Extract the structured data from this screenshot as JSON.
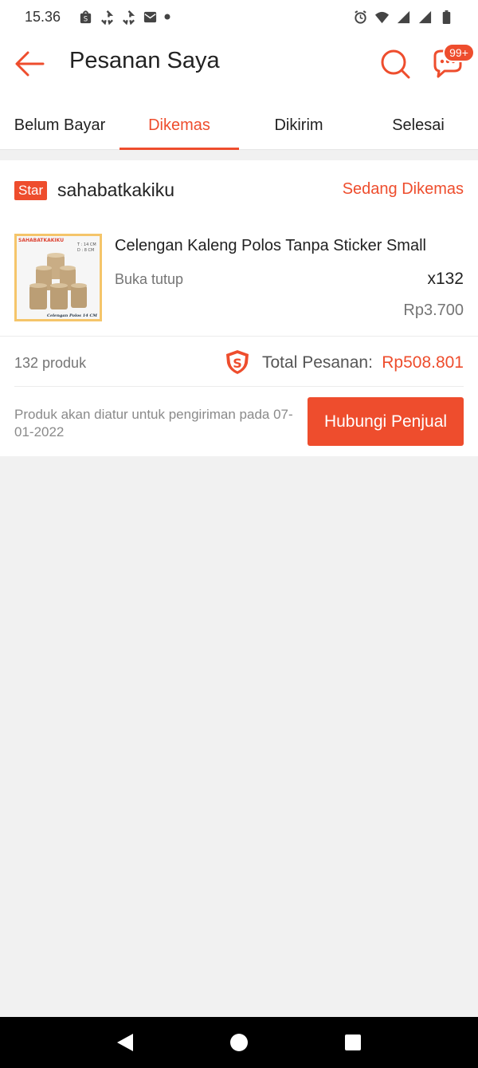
{
  "status_bar": {
    "time": "15.36",
    "left_icons": [
      "shopping-bag-icon",
      "sync-icon",
      "sync-icon",
      "mail-icon",
      "dot-icon"
    ],
    "right_icons": [
      "alarm-icon",
      "wifi-icon",
      "signal-icon",
      "signal-icon",
      "battery-icon"
    ]
  },
  "appbar": {
    "title": "Pesanan Saya",
    "chat_badge": "99+"
  },
  "tabs": [
    {
      "label": "Belum Bayar",
      "active": false
    },
    {
      "label": "Dikemas",
      "active": true
    },
    {
      "label": "Dikirim",
      "active": false
    },
    {
      "label": "Selesai",
      "active": false
    }
  ],
  "order": {
    "shop_badge": "Star",
    "shop_name": "sahabatkakiku",
    "status": "Sedang Dikemas",
    "product": {
      "title": "Celengan Kaleng Polos Tanpa Sticker Small",
      "variation": "Buka tutup",
      "quantity": "x132",
      "price": "Rp3.700",
      "thumb_brand_text": "SAHABATKAKIKU",
      "thumb_size_text": "T : 14 CM",
      "thumb_diameter_text": "D : 8 CM",
      "thumb_caption": "Celengan Polos 14 CM"
    },
    "product_count": "132 produk",
    "total_label": "Total Pesanan:",
    "total_value": "Rp508.801",
    "shipping_note": "Produk akan diatur untuk pengiriman pada 07-01-2022",
    "contact_button": "Hubungi Penjual"
  },
  "colors": {
    "accent": "#ee4d2d",
    "muted_text": "#757575",
    "background": "#f1f1f1"
  }
}
